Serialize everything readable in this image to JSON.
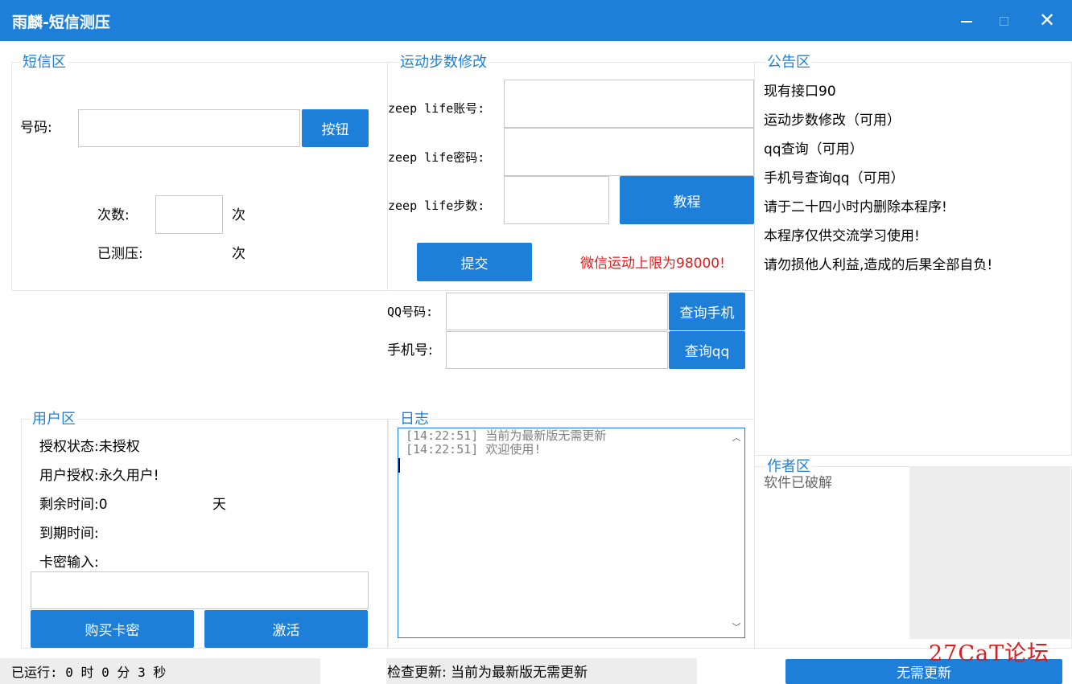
{
  "window": {
    "title": "雨麟-短信测压",
    "min_icon": "minimize-icon",
    "max_icon": "maximize-icon",
    "close_icon": "close-icon",
    "close_glyph": "✕"
  },
  "sms": {
    "legend": "短信区",
    "phone_label": "号码:",
    "phone_value": "",
    "button_label": "按钮",
    "count_label": "次数:",
    "count_value": "",
    "count_unit": "次",
    "tested_label": "已测压:",
    "tested_value": "",
    "tested_unit": "次"
  },
  "steps": {
    "legend": "运动步数修改",
    "account_label": "zeep life账号:",
    "password_label": "zeep life密码:",
    "steps_label": "zeep life步数:",
    "account_value": "",
    "password_value": "",
    "steps_value": "",
    "tutorial_label": "教程",
    "submit_label": "提交",
    "limit_note": "微信运动上限为98000!"
  },
  "lookup": {
    "qq_label": "QQ号码:",
    "qq_value": "",
    "phone_label": "手机号:",
    "phone_value": "",
    "query_phone_label": "查询手机",
    "query_qq_label": "查询qq"
  },
  "notice": {
    "legend": "公告区",
    "lines": [
      "现有接口90",
      "运动步数修改（可用）",
      "qq查询（可用）",
      "手机号查询qq（可用）",
      "请于二十四小时内删除本程序!",
      "本程序仅供交流学习使用!",
      "请勿损他人利益,造成的后果全部自负!"
    ]
  },
  "user": {
    "legend": "用户区",
    "auth_status": "授权状态:未授权",
    "auth_type": "用户授权:永久用户!",
    "remaining_label": "剩余时间:0",
    "remaining_unit": "天",
    "expiry_label": "到期时间:",
    "card_label": "卡密输入:",
    "card_value": "",
    "buy_label": "购买卡密",
    "activate_label": "激活"
  },
  "log": {
    "legend": "日志",
    "lines": [
      "[14:22:51] 当前为最新版无需更新",
      "[14:22:51] 欢迎使用!"
    ],
    "scroll_up_glyph": "︿",
    "scroll_down_glyph": "﹀"
  },
  "author": {
    "legend": "作者区",
    "text": "软件已破解"
  },
  "status": {
    "running": "已运行: 0 时 0 分 3 秒",
    "update_check": "检查更新: 当前为最新版无需更新",
    "update_button": "无需更新"
  },
  "watermark": "27CaT论坛",
  "colors": {
    "accent": "#1e7fd8",
    "warning": "#e81818"
  }
}
